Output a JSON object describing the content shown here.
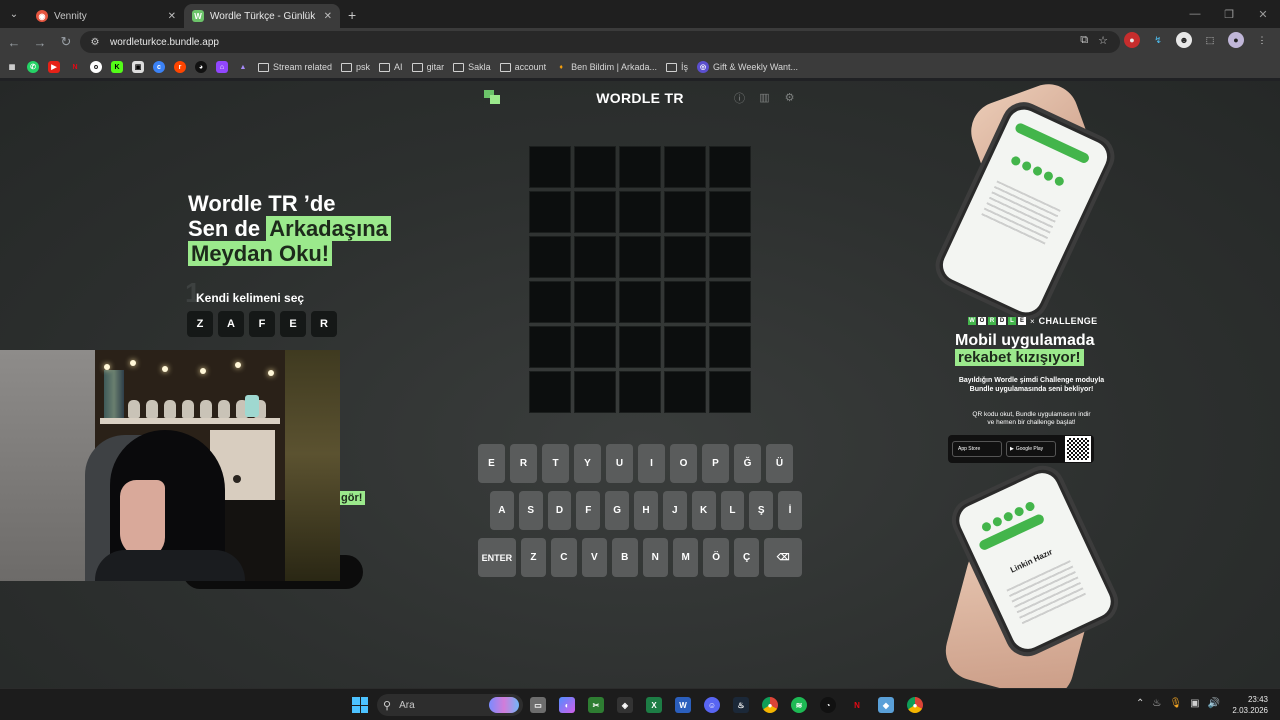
{
  "browser": {
    "tabs": [
      {
        "title": "Vennity",
        "active": false,
        "favicon_color": "#e5553f"
      },
      {
        "title": "Wordle Türkçe - Günlük Kelime",
        "active": true,
        "favicon_color": "#6cc46a",
        "favicon_letter": "W"
      }
    ],
    "address": "wordleturkce.bundle.app",
    "bookmarks": [
      "Stream related",
      "psk",
      "AI",
      "gitar",
      "Sakla",
      "account",
      "Ben Bildim | Arkada...",
      "İş",
      "Gift & Weekly Want..."
    ]
  },
  "game": {
    "title": "WORDLE TR",
    "rows": 6,
    "cols": 5,
    "keyboard": {
      "row1": [
        "E",
        "R",
        "T",
        "Y",
        "U",
        "I",
        "O",
        "P",
        "Ğ",
        "Ü"
      ],
      "row2": [
        "A",
        "S",
        "D",
        "F",
        "G",
        "H",
        "J",
        "K",
        "L",
        "Ş",
        "İ"
      ],
      "row3": [
        "ENTER",
        "Z",
        "C",
        "V",
        "B",
        "N",
        "M",
        "Ö",
        "Ç",
        "⌫"
      ]
    }
  },
  "left_promo": {
    "line1": "Wordle TR ’de",
    "line2_prefix": "Sen de",
    "line2_highlight": "Arkadaşına",
    "line3_highlight": "Meydan Oku!",
    "step_number": "1",
    "step_text": "Kendi kelimeni seç",
    "word_letters": [
      "Z",
      "A",
      "F",
      "E",
      "R"
    ],
    "partial_highlight": "gör!"
  },
  "right_promo": {
    "brand_letters": [
      "W",
      "O",
      "R",
      "D",
      "L",
      "E"
    ],
    "times": "×",
    "challenge": "CHALLENGE",
    "headline1": "Mobil uygulamada",
    "headline2": "rekabet kızışıyor!",
    "desc1a": "Bayıldığın Wordle şimdi Challenge moduyla",
    "desc1b": "Bundle uygulamasında seni bekliyor!",
    "desc2a": "QR kodu okut, Bundle uygulamasını indir",
    "desc2b": "ve hemen bir challenge başlat!",
    "app_store": "App Store",
    "google_play": "Google Play",
    "phone2_title": "Linkin Hazır"
  },
  "taskbar": {
    "search_placeholder": "Ara",
    "time": "23:43",
    "date": "2.03.2026"
  }
}
